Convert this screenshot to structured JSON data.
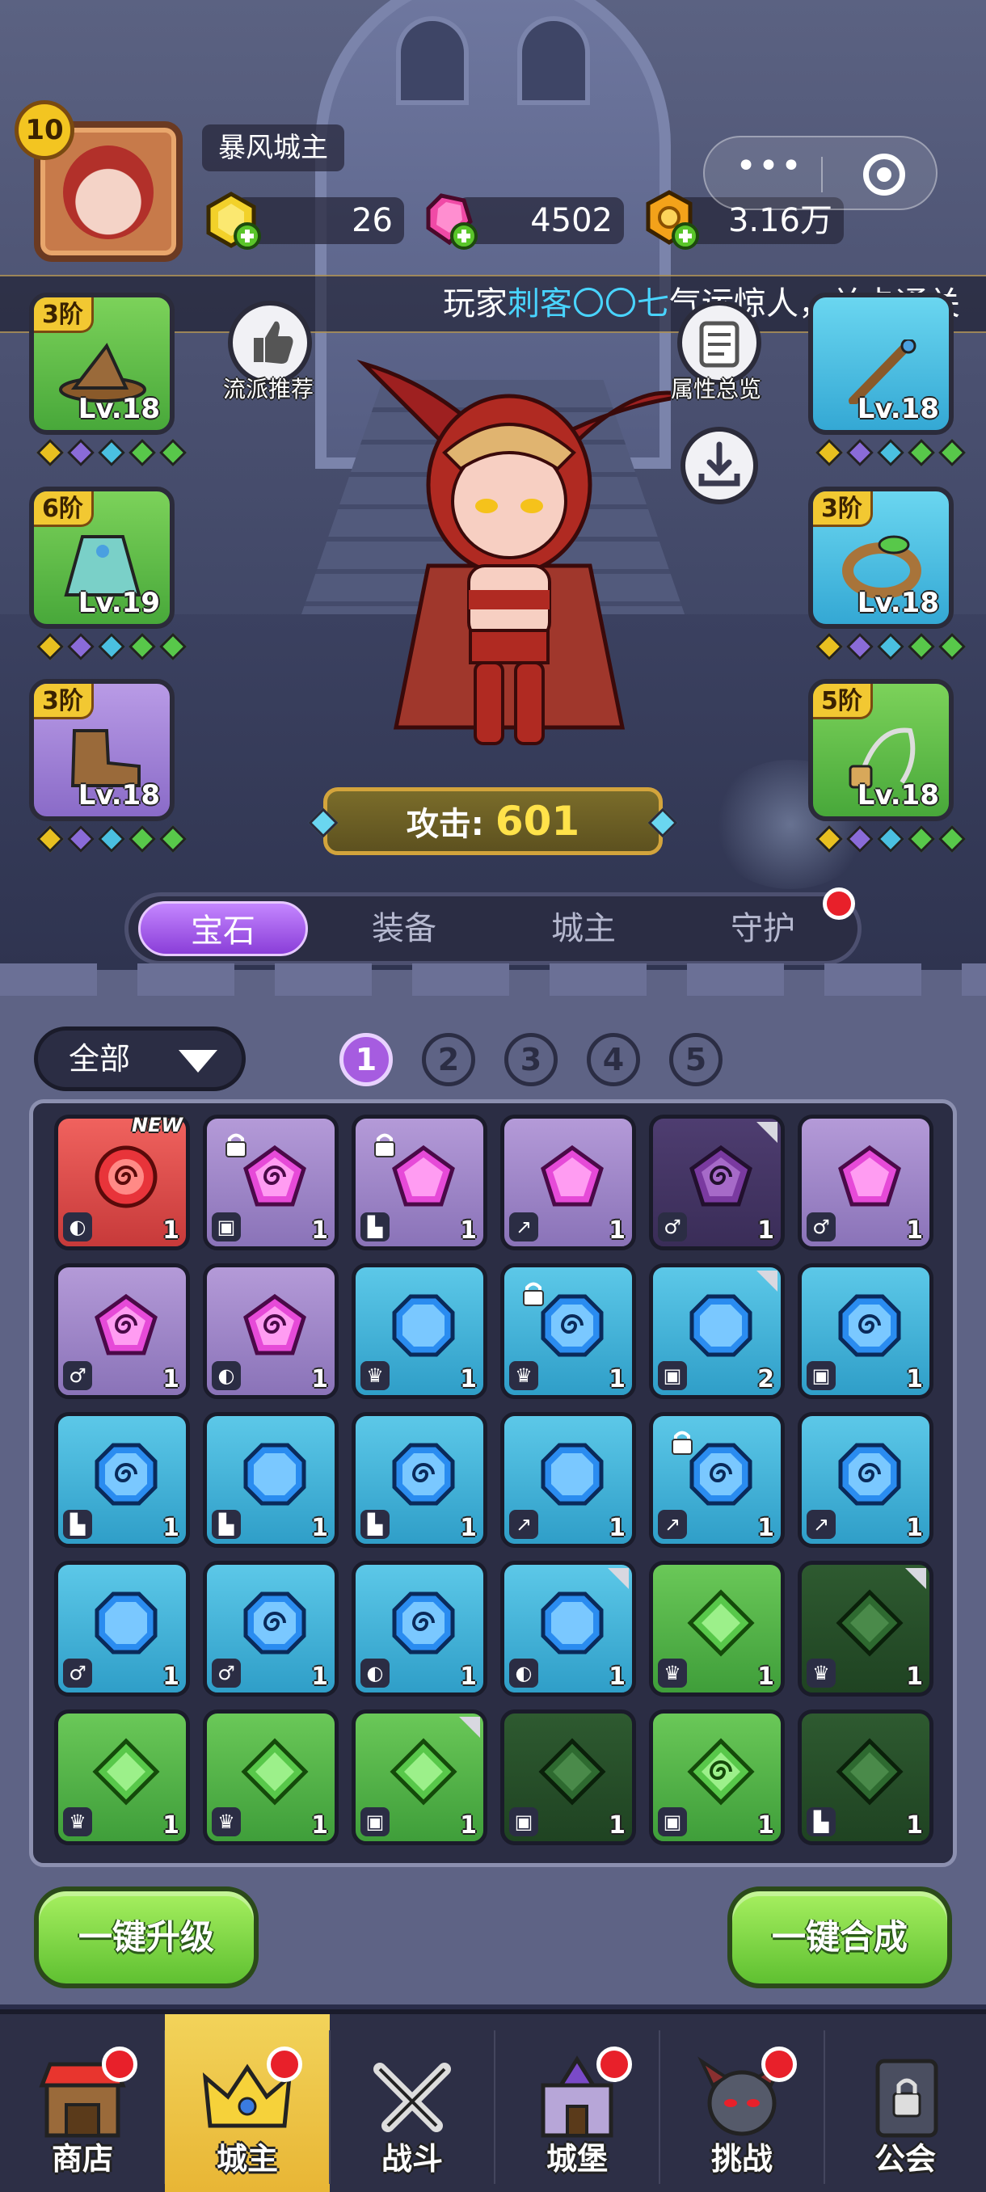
{
  "player": {
    "name": "暴风城主",
    "level": "10"
  },
  "resources": {
    "gold": "26",
    "gem": "4502",
    "coin": "3.16万"
  },
  "marquee": {
    "prefix": "玩家",
    "highlight": "刺客〇〇七",
    "suffix": "气运惊人，关卡通关"
  },
  "side_buttons": {
    "left_label": "流派推荐",
    "right_label": "属性总览"
  },
  "equipment": {
    "left": [
      {
        "tier": "3阶",
        "level": "Lv.18",
        "color": "green",
        "item": "hat"
      },
      {
        "tier": "6阶",
        "level": "Lv.19",
        "color": "green",
        "item": "robe"
      },
      {
        "tier": "3阶",
        "level": "Lv.18",
        "color": "purple",
        "item": "boot"
      }
    ],
    "right": [
      {
        "tier": "",
        "level": "Lv.18",
        "color": "blue",
        "item": "staff"
      },
      {
        "tier": "3阶",
        "level": "Lv.18",
        "color": "blue",
        "item": "ring"
      },
      {
        "tier": "5阶",
        "level": "Lv.18",
        "color": "green",
        "item": "amulet"
      }
    ]
  },
  "attack": {
    "label": "攻击:",
    "value": "601"
  },
  "tabs": [
    "宝石",
    "装备",
    "城主",
    "守护"
  ],
  "filter": {
    "label": "全部"
  },
  "pages": [
    "1",
    "2",
    "3",
    "4",
    "5"
  ],
  "inventory": [
    {
      "color": "red",
      "gem": "spiral",
      "slot": "ring",
      "count": "1",
      "new": "NEW"
    },
    {
      "color": "purple",
      "gem": "spiral",
      "slot": "armor",
      "count": "1",
      "lock": true
    },
    {
      "color": "purple",
      "gem": "plain",
      "slot": "boot",
      "count": "1",
      "lock": true
    },
    {
      "color": "purple",
      "gem": "plain",
      "slot": "weapon",
      "count": "1"
    },
    {
      "color": "purple-dark",
      "gem": "spiral",
      "slot": "amulet",
      "count": "1",
      "corner": true
    },
    {
      "color": "purple",
      "gem": "plain",
      "slot": "amulet",
      "count": "1"
    },
    {
      "color": "purple",
      "gem": "spiral",
      "slot": "amulet",
      "count": "1"
    },
    {
      "color": "purple",
      "gem": "spiral",
      "slot": "ring",
      "count": "1"
    },
    {
      "color": "blue",
      "gem": "plain",
      "slot": "crown",
      "count": "1"
    },
    {
      "color": "blue",
      "gem": "spiral",
      "slot": "crown",
      "count": "1",
      "lock": true
    },
    {
      "color": "blue",
      "gem": "plain",
      "slot": "armor",
      "count": "2",
      "corner": true
    },
    {
      "color": "blue",
      "gem": "spiral",
      "slot": "armor",
      "count": "1"
    },
    {
      "color": "blue",
      "gem": "spiral",
      "slot": "boot",
      "count": "1"
    },
    {
      "color": "blue",
      "gem": "plain",
      "slot": "boot",
      "count": "1"
    },
    {
      "color": "blue",
      "gem": "spiral",
      "slot": "boot",
      "count": "1"
    },
    {
      "color": "blue",
      "gem": "plain",
      "slot": "weapon",
      "count": "1"
    },
    {
      "color": "blue",
      "gem": "spiral",
      "slot": "weapon",
      "count": "1",
      "lock": true
    },
    {
      "color": "blue",
      "gem": "spiral",
      "slot": "weapon",
      "count": "1"
    },
    {
      "color": "blue",
      "gem": "plain",
      "slot": "amulet",
      "count": "1"
    },
    {
      "color": "blue",
      "gem": "spiral",
      "slot": "amulet",
      "count": "1"
    },
    {
      "color": "blue",
      "gem": "spiral",
      "slot": "ring",
      "count": "1"
    },
    {
      "color": "blue",
      "gem": "plain",
      "slot": "ring",
      "count": "1",
      "corner": true
    },
    {
      "color": "green",
      "gem": "plain",
      "slot": "crown",
      "count": "1"
    },
    {
      "color": "green-dark",
      "gem": "plain",
      "slot": "crown",
      "count": "1",
      "corner": true
    },
    {
      "color": "green",
      "gem": "plain",
      "slot": "crown",
      "count": "1"
    },
    {
      "color": "green",
      "gem": "plain",
      "slot": "crown",
      "count": "1"
    },
    {
      "color": "green",
      "gem": "plain",
      "slot": "armor",
      "count": "1",
      "corner": true
    },
    {
      "color": "green-dark",
      "gem": "plain",
      "slot": "armor",
      "count": "1"
    },
    {
      "color": "green",
      "gem": "spiral",
      "slot": "armor",
      "count": "1"
    },
    {
      "color": "green-dark",
      "gem": "plain",
      "slot": "boot",
      "count": "1"
    }
  ],
  "actions": {
    "upgrade_all": "一键升级",
    "merge_all": "一键合成"
  },
  "nav": [
    "商店",
    "城主",
    "战斗",
    "城堡",
    "挑战",
    "公会"
  ],
  "colors": {
    "accent_purple": "#a65ce0",
    "button_green": "#5fc031",
    "highlight_cyan": "#49d4ff",
    "attack_yellow": "#ffe24a"
  }
}
